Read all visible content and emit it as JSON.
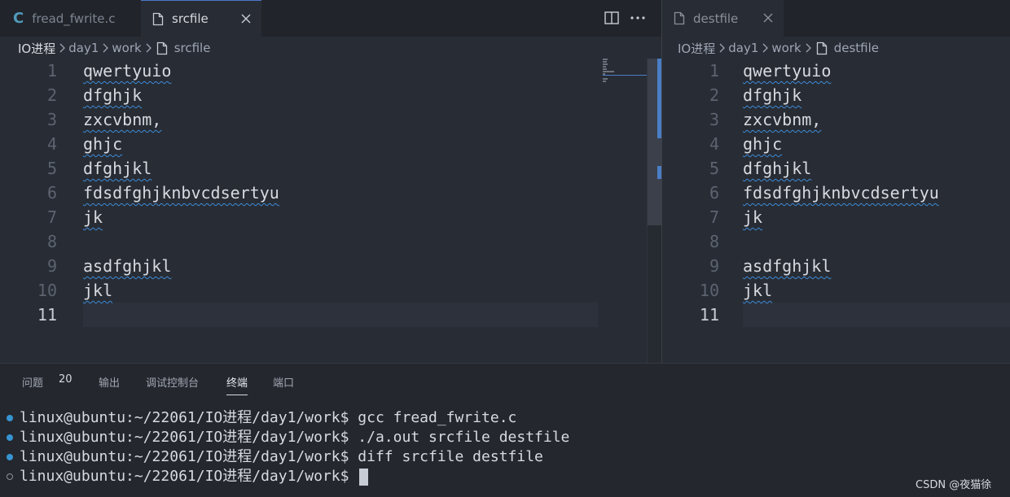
{
  "left_editor": {
    "tabs": [
      {
        "label": "fread_fwrite.c",
        "icon": "c-language-icon"
      },
      {
        "label": "srcfile",
        "icon": "file-icon"
      }
    ],
    "c_icon_glyph": "C",
    "breadcrumb": [
      "IO进程",
      "day1",
      "work",
      "srcfile"
    ],
    "lines": [
      "qwertyuio",
      "dfghjk",
      "zxcvbnm,",
      "ghjc",
      "dfghjkl",
      "fdsdfghjknbvcdsertyu",
      "jk",
      "",
      "asdfghjkl",
      "jkl",
      ""
    ],
    "line_numbers": [
      "1",
      "2",
      "3",
      "4",
      "5",
      "6",
      "7",
      "8",
      "9",
      "10",
      "11"
    ],
    "current_line": "11"
  },
  "right_editor": {
    "tabs": [
      {
        "label": "destfile",
        "icon": "file-icon"
      }
    ],
    "breadcrumb": [
      "IO进程",
      "day1",
      "work",
      "destfile"
    ],
    "lines": [
      "qwertyuio",
      "dfghjk",
      "zxcvbnm,",
      "ghjc",
      "dfghjkl",
      "fdsdfghjknbvcdsertyu",
      "jk",
      "",
      "asdfghjkl",
      "jkl",
      ""
    ],
    "line_numbers": [
      "1",
      "2",
      "3",
      "4",
      "5",
      "6",
      "7",
      "8",
      "9",
      "10",
      "11"
    ],
    "current_line": "11"
  },
  "panel": {
    "tabs": [
      "问题",
      "输出",
      "调试控制台",
      "终端",
      "端口"
    ],
    "active_tab": "终端",
    "problems_count": "20",
    "terminal_lines": [
      {
        "prompt": "linux@ubuntu:~/22061/IO进程/day1/work$ ",
        "command": "gcc fread_fwrite.c"
      },
      {
        "prompt": "linux@ubuntu:~/22061/IO进程/day1/work$ ",
        "command": "./a.out srcfile destfile"
      },
      {
        "prompt": "linux@ubuntu:~/22061/IO进程/day1/work$ ",
        "command": "diff srcfile destfile"
      },
      {
        "prompt": "linux@ubuntu:~/22061/IO进程/day1/work$ ",
        "command": ""
      }
    ]
  },
  "watermark": "CSDN @夜猫徐",
  "colors": {
    "editor_bg": "#282c34",
    "tabbar_bg": "#21252b",
    "accent": "#4d78cc",
    "terminal_dot": "#3794d1",
    "squiggle": "#3d8bd8"
  }
}
